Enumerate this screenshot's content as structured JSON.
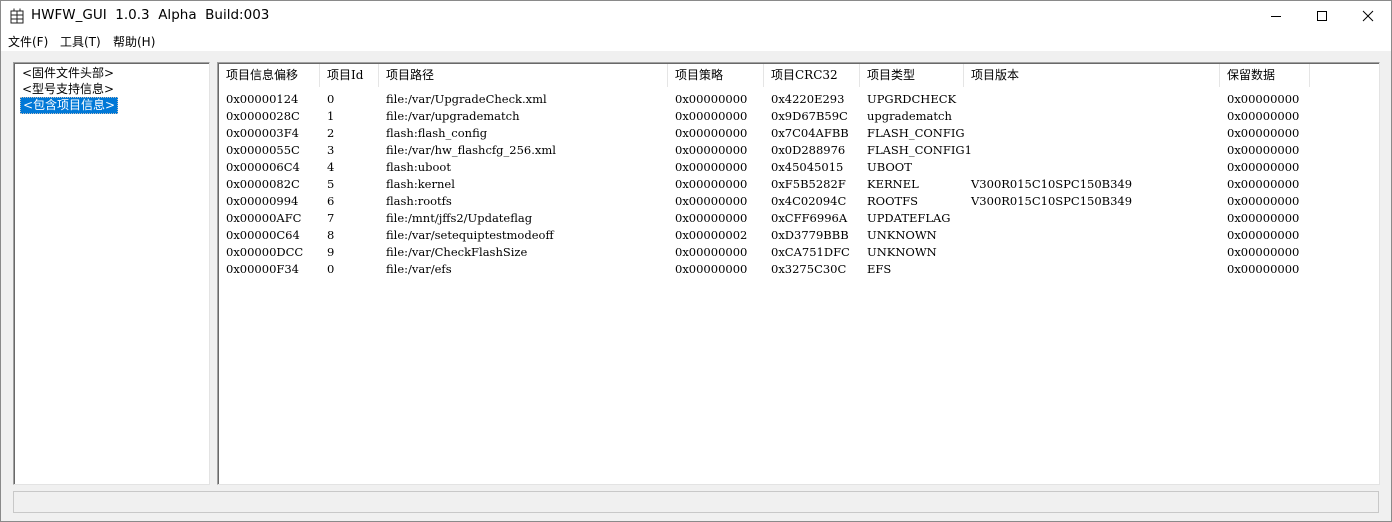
{
  "window": {
    "title": "HWFW_GUI  1.0.3  Alpha  Build:003",
    "app_icon": "firmware-app-icon",
    "controls": {
      "minimize_icon": "minimize-icon",
      "maximize_icon": "maximize-icon",
      "close_icon": "close-icon"
    }
  },
  "menu": {
    "items": [
      {
        "label": "文件(F)"
      },
      {
        "label": "工具(T)"
      },
      {
        "label": "帮助(H)"
      }
    ]
  },
  "tree": {
    "nodes": [
      {
        "label": "<固件文件头部>",
        "selected": false
      },
      {
        "label": "<型号支持信息>",
        "selected": false
      },
      {
        "label": "<包含项目信息>",
        "selected": true
      }
    ],
    "selection_color": "#0078d7"
  },
  "list": {
    "columns": [
      "项目信息偏移",
      "项目Id",
      "项目路径",
      "项目策略",
      "项目CRC32",
      "项目类型",
      "项目版本",
      "保留数据"
    ],
    "rows": [
      [
        "0x00000124",
        "0",
        "file:/var/UpgradeCheck.xml",
        "0x00000000",
        "0x4220E293",
        "UPGRDCHECK",
        "",
        "0x00000000"
      ],
      [
        "0x0000028C",
        "1",
        "file:/var/upgradematch",
        "0x00000000",
        "0x9D67B59C",
        "upgradematch",
        "",
        "0x00000000"
      ],
      [
        "0x000003F4",
        "2",
        "flash:flash_config",
        "0x00000000",
        "0x7C04AFBB",
        "FLASH_CONFIG",
        "",
        "0x00000000"
      ],
      [
        "0x0000055C",
        "3",
        "file:/var/hw_flashcfg_256.xml",
        "0x00000000",
        "0x0D288976",
        "FLASH_CONFIG1",
        "",
        "0x00000000"
      ],
      [
        "0x000006C4",
        "4",
        "flash:uboot",
        "0x00000000",
        "0x45045015",
        "UBOOT",
        "",
        "0x00000000"
      ],
      [
        "0x0000082C",
        "5",
        "flash:kernel",
        "0x00000000",
        "0xF5B5282F",
        "KERNEL",
        "V300R015C10SPC150B349",
        "0x00000000"
      ],
      [
        "0x00000994",
        "6",
        "flash:rootfs",
        "0x00000000",
        "0x4C02094C",
        "ROOTFS",
        "V300R015C10SPC150B349",
        "0x00000000"
      ],
      [
        "0x00000AFC",
        "7",
        "file:/mnt/jffs2/Updateflag",
        "0x00000000",
        "0xCFF6996A",
        "UPDATEFLAG",
        "",
        "0x00000000"
      ],
      [
        "0x00000C64",
        "8",
        "file:/var/setequiptestmodeoff",
        "0x00000002",
        "0xD3779BBB",
        "UNKNOWN",
        "",
        "0x00000000"
      ],
      [
        "0x00000DCC",
        "9",
        "file:/var/CheckFlashSize",
        "0x00000000",
        "0xCA751DFC",
        "UNKNOWN",
        "",
        "0x00000000"
      ],
      [
        "0x00000F34",
        "0",
        "file:/var/efs",
        "0x00000000",
        "0x3275C30C",
        "EFS",
        "",
        "0x00000000"
      ]
    ]
  },
  "statusbar": {
    "text": ""
  }
}
